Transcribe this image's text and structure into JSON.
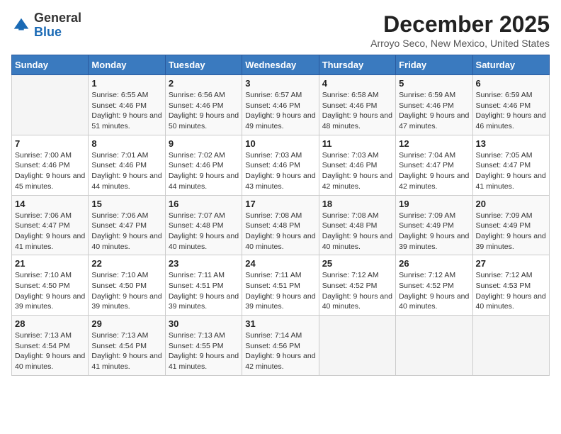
{
  "header": {
    "logo_general": "General",
    "logo_blue": "Blue",
    "month_title": "December 2025",
    "location": "Arroyo Seco, New Mexico, United States"
  },
  "days_of_week": [
    "Sunday",
    "Monday",
    "Tuesday",
    "Wednesday",
    "Thursday",
    "Friday",
    "Saturday"
  ],
  "weeks": [
    [
      {
        "day": "",
        "sunrise": "",
        "sunset": "",
        "daylight": ""
      },
      {
        "day": "1",
        "sunrise": "Sunrise: 6:55 AM",
        "sunset": "Sunset: 4:46 PM",
        "daylight": "Daylight: 9 hours and 51 minutes."
      },
      {
        "day": "2",
        "sunrise": "Sunrise: 6:56 AM",
        "sunset": "Sunset: 4:46 PM",
        "daylight": "Daylight: 9 hours and 50 minutes."
      },
      {
        "day": "3",
        "sunrise": "Sunrise: 6:57 AM",
        "sunset": "Sunset: 4:46 PM",
        "daylight": "Daylight: 9 hours and 49 minutes."
      },
      {
        "day": "4",
        "sunrise": "Sunrise: 6:58 AM",
        "sunset": "Sunset: 4:46 PM",
        "daylight": "Daylight: 9 hours and 48 minutes."
      },
      {
        "day": "5",
        "sunrise": "Sunrise: 6:59 AM",
        "sunset": "Sunset: 4:46 PM",
        "daylight": "Daylight: 9 hours and 47 minutes."
      },
      {
        "day": "6",
        "sunrise": "Sunrise: 6:59 AM",
        "sunset": "Sunset: 4:46 PM",
        "daylight": "Daylight: 9 hours and 46 minutes."
      }
    ],
    [
      {
        "day": "7",
        "sunrise": "Sunrise: 7:00 AM",
        "sunset": "Sunset: 4:46 PM",
        "daylight": "Daylight: 9 hours and 45 minutes."
      },
      {
        "day": "8",
        "sunrise": "Sunrise: 7:01 AM",
        "sunset": "Sunset: 4:46 PM",
        "daylight": "Daylight: 9 hours and 44 minutes."
      },
      {
        "day": "9",
        "sunrise": "Sunrise: 7:02 AM",
        "sunset": "Sunset: 4:46 PM",
        "daylight": "Daylight: 9 hours and 44 minutes."
      },
      {
        "day": "10",
        "sunrise": "Sunrise: 7:03 AM",
        "sunset": "Sunset: 4:46 PM",
        "daylight": "Daylight: 9 hours and 43 minutes."
      },
      {
        "day": "11",
        "sunrise": "Sunrise: 7:03 AM",
        "sunset": "Sunset: 4:46 PM",
        "daylight": "Daylight: 9 hours and 42 minutes."
      },
      {
        "day": "12",
        "sunrise": "Sunrise: 7:04 AM",
        "sunset": "Sunset: 4:47 PM",
        "daylight": "Daylight: 9 hours and 42 minutes."
      },
      {
        "day": "13",
        "sunrise": "Sunrise: 7:05 AM",
        "sunset": "Sunset: 4:47 PM",
        "daylight": "Daylight: 9 hours and 41 minutes."
      }
    ],
    [
      {
        "day": "14",
        "sunrise": "Sunrise: 7:06 AM",
        "sunset": "Sunset: 4:47 PM",
        "daylight": "Daylight: 9 hours and 41 minutes."
      },
      {
        "day": "15",
        "sunrise": "Sunrise: 7:06 AM",
        "sunset": "Sunset: 4:47 PM",
        "daylight": "Daylight: 9 hours and 40 minutes."
      },
      {
        "day": "16",
        "sunrise": "Sunrise: 7:07 AM",
        "sunset": "Sunset: 4:48 PM",
        "daylight": "Daylight: 9 hours and 40 minutes."
      },
      {
        "day": "17",
        "sunrise": "Sunrise: 7:08 AM",
        "sunset": "Sunset: 4:48 PM",
        "daylight": "Daylight: 9 hours and 40 minutes."
      },
      {
        "day": "18",
        "sunrise": "Sunrise: 7:08 AM",
        "sunset": "Sunset: 4:48 PM",
        "daylight": "Daylight: 9 hours and 40 minutes."
      },
      {
        "day": "19",
        "sunrise": "Sunrise: 7:09 AM",
        "sunset": "Sunset: 4:49 PM",
        "daylight": "Daylight: 9 hours and 39 minutes."
      },
      {
        "day": "20",
        "sunrise": "Sunrise: 7:09 AM",
        "sunset": "Sunset: 4:49 PM",
        "daylight": "Daylight: 9 hours and 39 minutes."
      }
    ],
    [
      {
        "day": "21",
        "sunrise": "Sunrise: 7:10 AM",
        "sunset": "Sunset: 4:50 PM",
        "daylight": "Daylight: 9 hours and 39 minutes."
      },
      {
        "day": "22",
        "sunrise": "Sunrise: 7:10 AM",
        "sunset": "Sunset: 4:50 PM",
        "daylight": "Daylight: 9 hours and 39 minutes."
      },
      {
        "day": "23",
        "sunrise": "Sunrise: 7:11 AM",
        "sunset": "Sunset: 4:51 PM",
        "daylight": "Daylight: 9 hours and 39 minutes."
      },
      {
        "day": "24",
        "sunrise": "Sunrise: 7:11 AM",
        "sunset": "Sunset: 4:51 PM",
        "daylight": "Daylight: 9 hours and 39 minutes."
      },
      {
        "day": "25",
        "sunrise": "Sunrise: 7:12 AM",
        "sunset": "Sunset: 4:52 PM",
        "daylight": "Daylight: 9 hours and 40 minutes."
      },
      {
        "day": "26",
        "sunrise": "Sunrise: 7:12 AM",
        "sunset": "Sunset: 4:52 PM",
        "daylight": "Daylight: 9 hours and 40 minutes."
      },
      {
        "day": "27",
        "sunrise": "Sunrise: 7:12 AM",
        "sunset": "Sunset: 4:53 PM",
        "daylight": "Daylight: 9 hours and 40 minutes."
      }
    ],
    [
      {
        "day": "28",
        "sunrise": "Sunrise: 7:13 AM",
        "sunset": "Sunset: 4:54 PM",
        "daylight": "Daylight: 9 hours and 40 minutes."
      },
      {
        "day": "29",
        "sunrise": "Sunrise: 7:13 AM",
        "sunset": "Sunset: 4:54 PM",
        "daylight": "Daylight: 9 hours and 41 minutes."
      },
      {
        "day": "30",
        "sunrise": "Sunrise: 7:13 AM",
        "sunset": "Sunset: 4:55 PM",
        "daylight": "Daylight: 9 hours and 41 minutes."
      },
      {
        "day": "31",
        "sunrise": "Sunrise: 7:14 AM",
        "sunset": "Sunset: 4:56 PM",
        "daylight": "Daylight: 9 hours and 42 minutes."
      },
      {
        "day": "",
        "sunrise": "",
        "sunset": "",
        "daylight": ""
      },
      {
        "day": "",
        "sunrise": "",
        "sunset": "",
        "daylight": ""
      },
      {
        "day": "",
        "sunrise": "",
        "sunset": "",
        "daylight": ""
      }
    ]
  ]
}
